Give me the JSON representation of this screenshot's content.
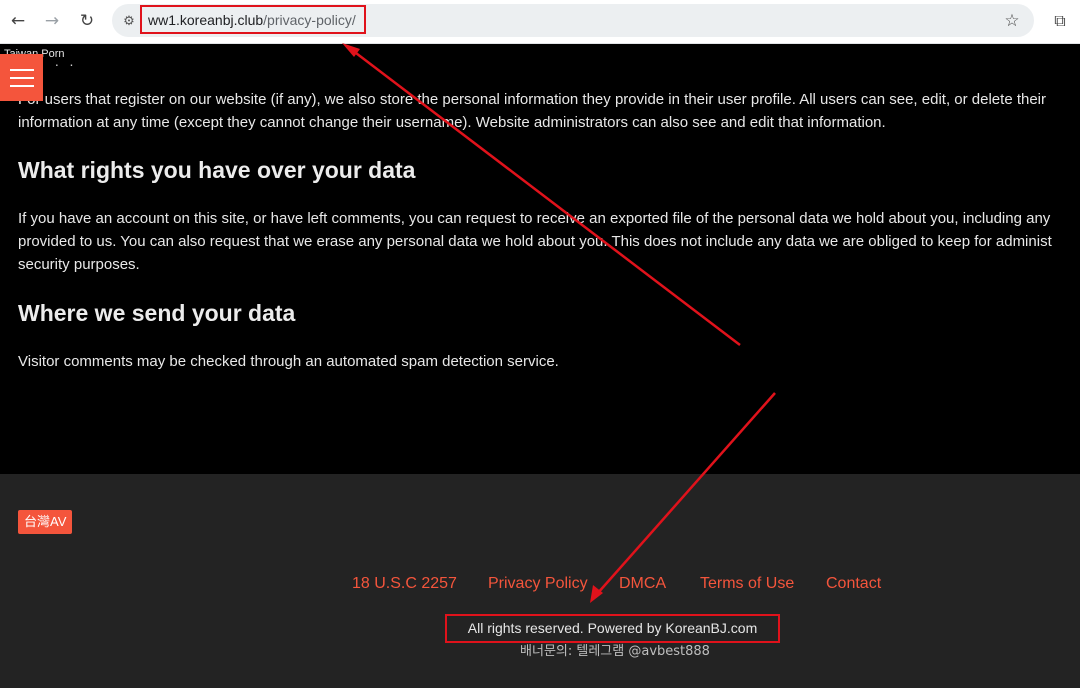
{
  "browser": {
    "back_icon": "←",
    "forward_icon": "→",
    "reload_icon": "↻",
    "site_info_icon": "⚙",
    "url_domain": "ww1.koreanbj.club",
    "url_path": "/privacy-policy/",
    "star_icon": "☆",
    "extensions_icon": "⧉"
  },
  "header": {
    "site_title": "Taiwan Porn",
    "top_fragment": "· · ·"
  },
  "content": {
    "para1_line1": "For users that register on our website (if any), we also store the personal information they provide in their user profile. All users can see, edit, or delete their",
    "para1_line2": "information at any time (except they cannot change their username). Website administrators can also see and edit that information.",
    "heading_rights": "What rights you have over your data",
    "para2_line1": "If you have an account on this site, or have left comments, you can request to receive an exported file of the personal data we hold about you, including any",
    "para2_line2": "provided to us. You can also request that we erase any personal data we hold about you. This does not include any data we are obliged to keep for administ",
    "para2_line3": "security purposes.",
    "heading_send": "Where we send your data",
    "para3_line1": "Visitor comments may be checked through an automated spam detection service."
  },
  "footer": {
    "tag_label": "台灣AV",
    "links": [
      "18 U.S.C 2257",
      "Privacy Policy",
      "DMCA",
      "Terms of Use",
      "Contact"
    ],
    "copyright": "All rights reserved. Powered by KoreanBJ.com",
    "banner": "배너문의: 텔레그램 @avbest888"
  },
  "colors": {
    "accent": "#f4553c",
    "annotation_red": "#e0121b",
    "footer_bg": "#232323",
    "page_bg": "#000000"
  }
}
